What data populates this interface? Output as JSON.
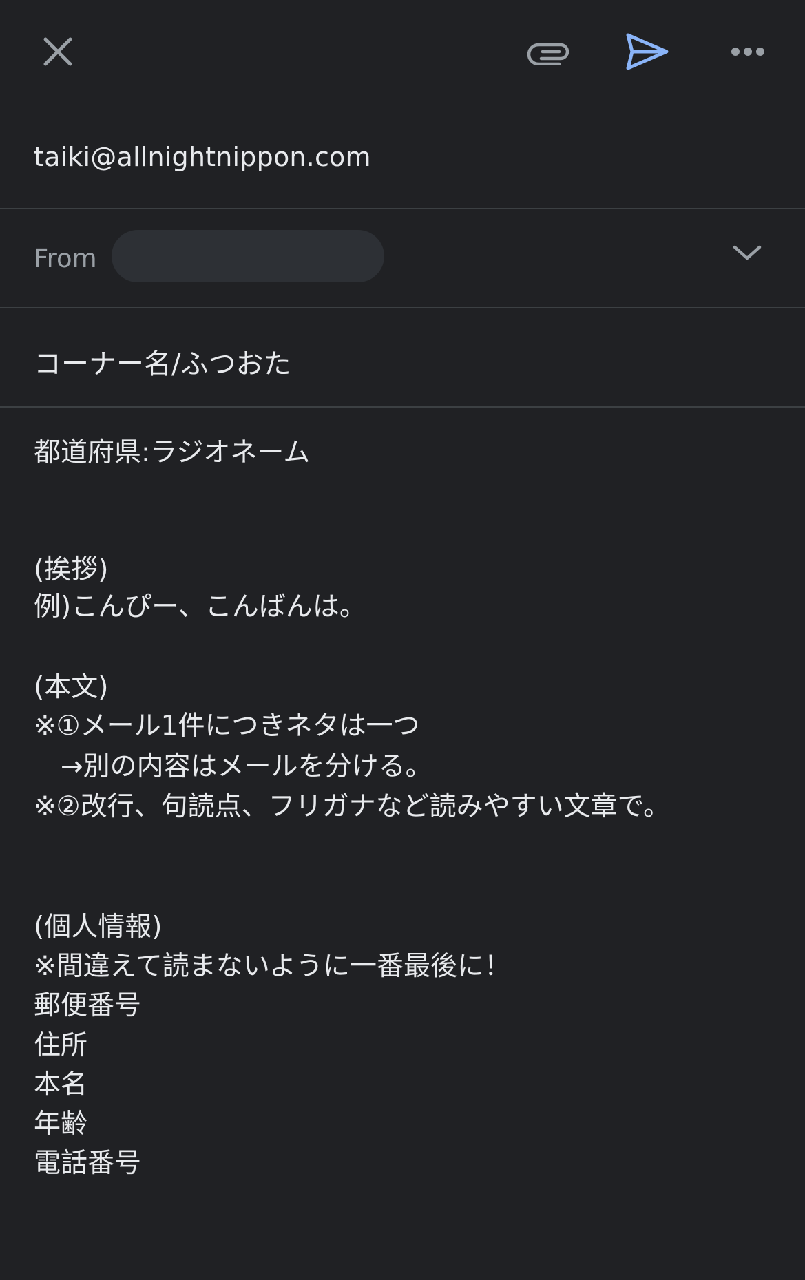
{
  "toolbar": {
    "close_icon": "close-icon",
    "attach_icon": "paperclip-icon",
    "send_icon": "send-icon",
    "more_icon": "more-horizontal-icon",
    "send_color": "#8ab4f8",
    "icon_color": "#9aa0a6"
  },
  "compose": {
    "to": "taiki@allnightnippon.com",
    "from_label": "From",
    "subject": "コーナー名/ふつおた"
  },
  "body": {
    "lines": [
      "都道府県:ラジオネーム",
      "(挨拶)",
      "例)こんぴー、こんばんは。",
      "(本文)",
      "※①メール1件につきネタは一つ",
      "　→別の内容はメールを分ける。",
      "※②改行、句読点、フリガナなど読みやすい文章で。",
      "(個人情報)",
      "※間違えて読まないように一番最後に！",
      "郵便番号",
      "住所",
      "本名",
      "年齢",
      "電話番号"
    ]
  },
  "colors": {
    "background": "#202124",
    "divider": "#3c4043",
    "text": "#e8eaed",
    "secondary_text": "#9aa0a6",
    "chip": "#2d3035",
    "accent": "#8ab4f8"
  }
}
